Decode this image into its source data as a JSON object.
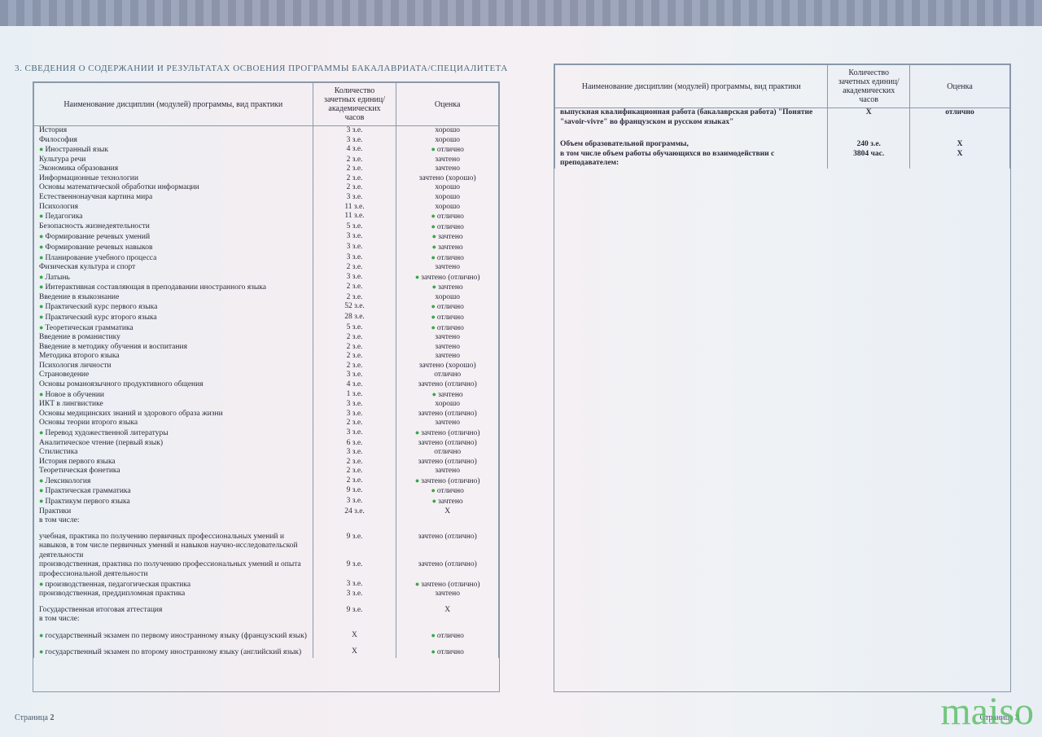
{
  "sectionTitle": "3. СВЕДЕНИЯ О СОДЕРЖАНИИ И РЕЗУЛЬТАТАХ ОСВОЕНИЯ ПРОГРАММЫ БАКАЛАВРИАТА/СПЕЦИАЛИТЕТА",
  "headers": {
    "name": "Наименование дисциплин (модулей) программы, вид практики",
    "credits": "Количество зачетных единиц/ академических часов",
    "grade": "Оценка"
  },
  "leftRows": [
    {
      "n": "История",
      "c": "3 з.е.",
      "g": "хорошо"
    },
    {
      "n": "Философия",
      "c": "3 з.е.",
      "g": "хорошо"
    },
    {
      "n": "Иностранный язык",
      "c": "4 з.е.",
      "g": "отлично",
      "nb": 1,
      "gb": 1
    },
    {
      "n": "Культура речи",
      "c": "2 з.е.",
      "g": "зачтено"
    },
    {
      "n": "Экономика образования",
      "c": "2 з.е.",
      "g": "зачтено"
    },
    {
      "n": "Информационные технологии",
      "c": "2 з.е.",
      "g": "зачтено (хорошо)"
    },
    {
      "n": "Основы математической обработки информации",
      "c": "2 з.е.",
      "g": "хорошо"
    },
    {
      "n": "Естественнонаучная картина мира",
      "c": "3 з.е.",
      "g": "хорошо"
    },
    {
      "n": "Психология",
      "c": "11 з.е.",
      "g": "хорошо"
    },
    {
      "n": "Педагогика",
      "c": "11 з.е.",
      "g": "отлично",
      "nb": 1,
      "gb": 1
    },
    {
      "n": "Безопасность жизнедеятельности",
      "c": "5 з.е.",
      "g": "отлично",
      "gb": 1
    },
    {
      "n": "Формирование речевых умений",
      "c": "3 з.е.",
      "g": "зачтено",
      "nb": 1,
      "gb": 1
    },
    {
      "n": "Формирование речевых навыков",
      "c": "3 з.е.",
      "g": "зачтено",
      "nb": 1,
      "gb": 1
    },
    {
      "n": "Планирование учебного процесса",
      "c": "3 з.е.",
      "g": "отлично",
      "nb": 1,
      "gb": 1
    },
    {
      "n": "Физическая культура и спорт",
      "c": "2 з.е.",
      "g": "зачтено"
    },
    {
      "n": "Латынь",
      "c": "3 з.е.",
      "g": "зачтено (отлично)",
      "nb": 1,
      "gb": 1
    },
    {
      "n": "Интерактивная составляющая в преподавании иностранного языка",
      "c": "2 з.е.",
      "g": "зачтено",
      "nb": 1,
      "gb": 1
    },
    {
      "n": "Введение в языкознание",
      "c": "2 з.е.",
      "g": "хорошо"
    },
    {
      "n": "Практический курс первого языка",
      "c": "52 з.е.",
      "g": "отлично",
      "nb": 1,
      "gb": 1
    },
    {
      "n": "Практический курс второго языка",
      "c": "28 з.е.",
      "g": "отлично",
      "nb": 1,
      "gb": 1
    },
    {
      "n": "Теоретическая грамматика",
      "c": "5 з.е.",
      "g": "отлично",
      "nb": 1,
      "gb": 1
    },
    {
      "n": "Введение в романистику",
      "c": "2 з.е.",
      "g": "зачтено"
    },
    {
      "n": "Введение в методику обучения и воспитания",
      "c": "2 з.е.",
      "g": "зачтено"
    },
    {
      "n": "Методика второго языка",
      "c": "2 з.е.",
      "g": "зачтено"
    },
    {
      "n": "Психология личности",
      "c": "2 з.е.",
      "g": "зачтено (хорошо)"
    },
    {
      "n": "Страноведение",
      "c": "3 з.е.",
      "g": "отлично"
    },
    {
      "n": "Основы романоязычного продуктивного общения",
      "c": "4 з.е.",
      "g": "зачтено (отлично)"
    },
    {
      "n": "Новое в обучении",
      "c": "1 з.е.",
      "g": "зачтено",
      "nb": 1,
      "gb": 1
    },
    {
      "n": "ИКТ в лингвистике",
      "c": "3 з.е.",
      "g": "хорошо"
    },
    {
      "n": "Основы медицинских знаний и здорового образа жизни",
      "c": "3 з.е.",
      "g": "зачтено (отлично)"
    },
    {
      "n": "Основы теории второго языка",
      "c": "2 з.е.",
      "g": "зачтено"
    },
    {
      "n": "Перевод художественной литературы",
      "c": "3 з.е.",
      "g": "зачтено (отлично)",
      "nb": 1,
      "gb": 1
    },
    {
      "n": "Аналитическое чтение (первый язык)",
      "c": "6 з.е.",
      "g": "зачтено (отлично)"
    },
    {
      "n": "Стилистика",
      "c": "3 з.е.",
      "g": "отлично"
    },
    {
      "n": "История первого языка",
      "c": "2 з.е.",
      "g": "зачтено (отлично)"
    },
    {
      "n": "Теоретическая фонетика",
      "c": "2 з.е.",
      "g": "зачтено"
    },
    {
      "n": "Лексикология",
      "c": "2 з.е.",
      "g": "зачтено (отлично)",
      "nb": 1,
      "gb": 1
    },
    {
      "n": "Практическая грамматика",
      "c": "9 з.е.",
      "g": "отлично",
      "nb": 1,
      "gb": 1
    },
    {
      "n": "Практикум первого языка",
      "c": "3 з.е.",
      "g": "зачтено",
      "nb": 1,
      "gb": 1
    },
    {
      "n": "Практики",
      "c": "24 з.е.",
      "g": "X"
    },
    {
      "n": "в том числе:",
      "c": "",
      "g": ""
    },
    {
      "sp": 1
    },
    {
      "n": "учебная, практика по получению первичных профессиональных умений и навыков, в том числе первичных умений и навыков научно-исследовательской деятельности",
      "c": "9 з.е.",
      "g": "зачтено (отлично)",
      "wrap": 1
    },
    {
      "n": "производственная, практика по получению профессиональных умений и опыта профессиональной деятельности",
      "c": "9 з.е.",
      "g": "зачтено (отлично)",
      "wrap": 1
    },
    {
      "n": "производственная, педагогическая практика",
      "c": "3 з.е.",
      "g": "зачтено (отлично)",
      "nb": 1,
      "gb": 1
    },
    {
      "n": "производственная, преддипломная практика",
      "c": "3 з.е.",
      "g": "зачтено"
    },
    {
      "sp": 1
    },
    {
      "n": "Государственная итоговая аттестация",
      "c": "9 з.е.",
      "g": "X"
    },
    {
      "n": "в том числе:",
      "c": "",
      "g": ""
    },
    {
      "sp": 1
    },
    {
      "n": "государственный экзамен по первому иностранному языку (французский язык)",
      "c": "X",
      "g": "отлично",
      "nb": 1,
      "gb": 1,
      "wrap": 1
    },
    {
      "sp": 1
    },
    {
      "n": "государственный экзамен по второму иностранному языку (английский язык)",
      "c": "X",
      "g": "отлично",
      "nb": 1,
      "gb": 1,
      "wrap": 1
    }
  ],
  "rightRows": [
    {
      "n": "выпускная квалификационная работа (бакалаврская работа) \"Понятие \"savoir-vivre\" во французском и русском языках\"",
      "c": "X",
      "g": "отлично",
      "wrap": 1,
      "bold": 1
    },
    {
      "sp": 1
    },
    {
      "sp": 1
    },
    {
      "n": "Объем образовательной программы,",
      "c": "240 з.е.",
      "g": "X",
      "bold": 1
    },
    {
      "n": "в том числе объем работы обучающихся во взаимодействии с преподавателем:",
      "c": "3804 час.",
      "g": "X",
      "wrap": 1,
      "bold": 1
    }
  ],
  "pageLeftLabel": "Страница",
  "pageLeftNum": "2",
  "pageRightLabel": "Страница",
  "pageRightNum": "3",
  "watermark": "maiso"
}
